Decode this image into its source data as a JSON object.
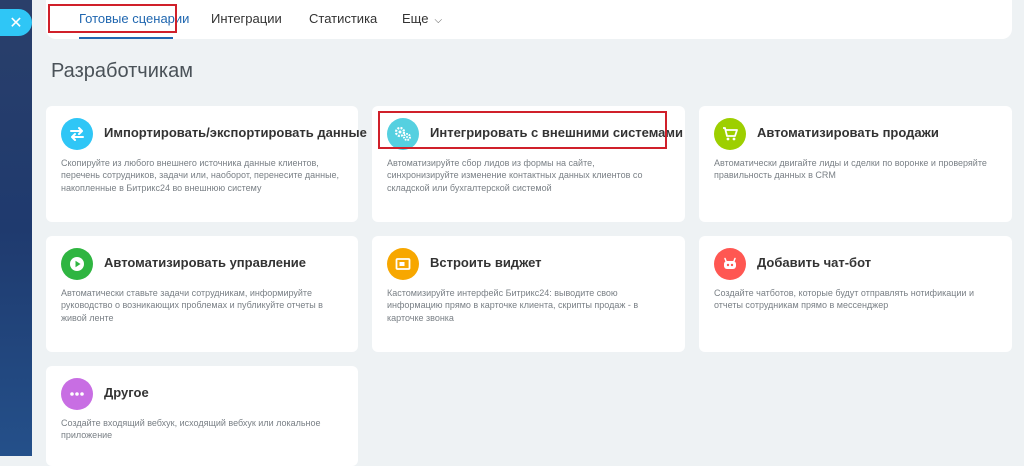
{
  "nav": {
    "close_icon": "close-icon",
    "tabs": [
      {
        "label": "Готовые сценарии"
      },
      {
        "label": "Интеграции"
      },
      {
        "label": "Статистика"
      },
      {
        "label": "Еще"
      }
    ]
  },
  "page": {
    "title": "Разработчикам"
  },
  "colors": {
    "accent": "#2067b0",
    "highlight": "#d0202a"
  },
  "cards": [
    {
      "title": "Импортировать/экспортировать данные",
      "icon": "arrows-exchange-icon",
      "color": "#2fc6f6",
      "desc": "Скопируйте из любого внешнего источника данные клиентов, перечень сотрудников, задачи или, наоборот, перенесите данные, накопленные в Битрикс24 во внешнюю систему"
    },
    {
      "title": "Интегрировать с внешними системами",
      "icon": "gears-icon",
      "color": "#55d0e0",
      "desc": "Автоматизируйте сбор лидов из формы на сайте, синхронизируйте изменение контактных данных клиентов со складской или бухгалтерской системой"
    },
    {
      "title": "Автоматизировать продажи",
      "icon": "cart-icon",
      "color": "#9dcf00",
      "desc": "Автоматически двигайте лиды и сделки по воронке и проверяйте правильность данных в CRM"
    },
    {
      "title": "Автоматизировать управление",
      "icon": "play-icon",
      "color": "#2fb541",
      "desc": "Автоматически ставьте задачи сотрудникам, информируйте руководство о возникающих проблемах и публикуйте отчеты в живой ленте"
    },
    {
      "title": "Встроить виджет",
      "icon": "widget-icon",
      "color": "#f7a700",
      "desc": "Кастомизируйте интерфейс Битрикс24: выводите свою информацию прямо в карточке клиента, скрипты продаж - в карточке звонка"
    },
    {
      "title": "Добавить чат-бот",
      "icon": "robot-icon",
      "color": "#ff5752",
      "desc": "Создайте чатботов, которые будут отправлять нотификации и отчеты сотрудникам прямо в мессенджер"
    },
    {
      "title": "Другое",
      "icon": "dots-icon",
      "color": "#c86ee3",
      "desc": "Создайте входящий вебхук, исходящий вебхук или локальное приложение"
    }
  ]
}
